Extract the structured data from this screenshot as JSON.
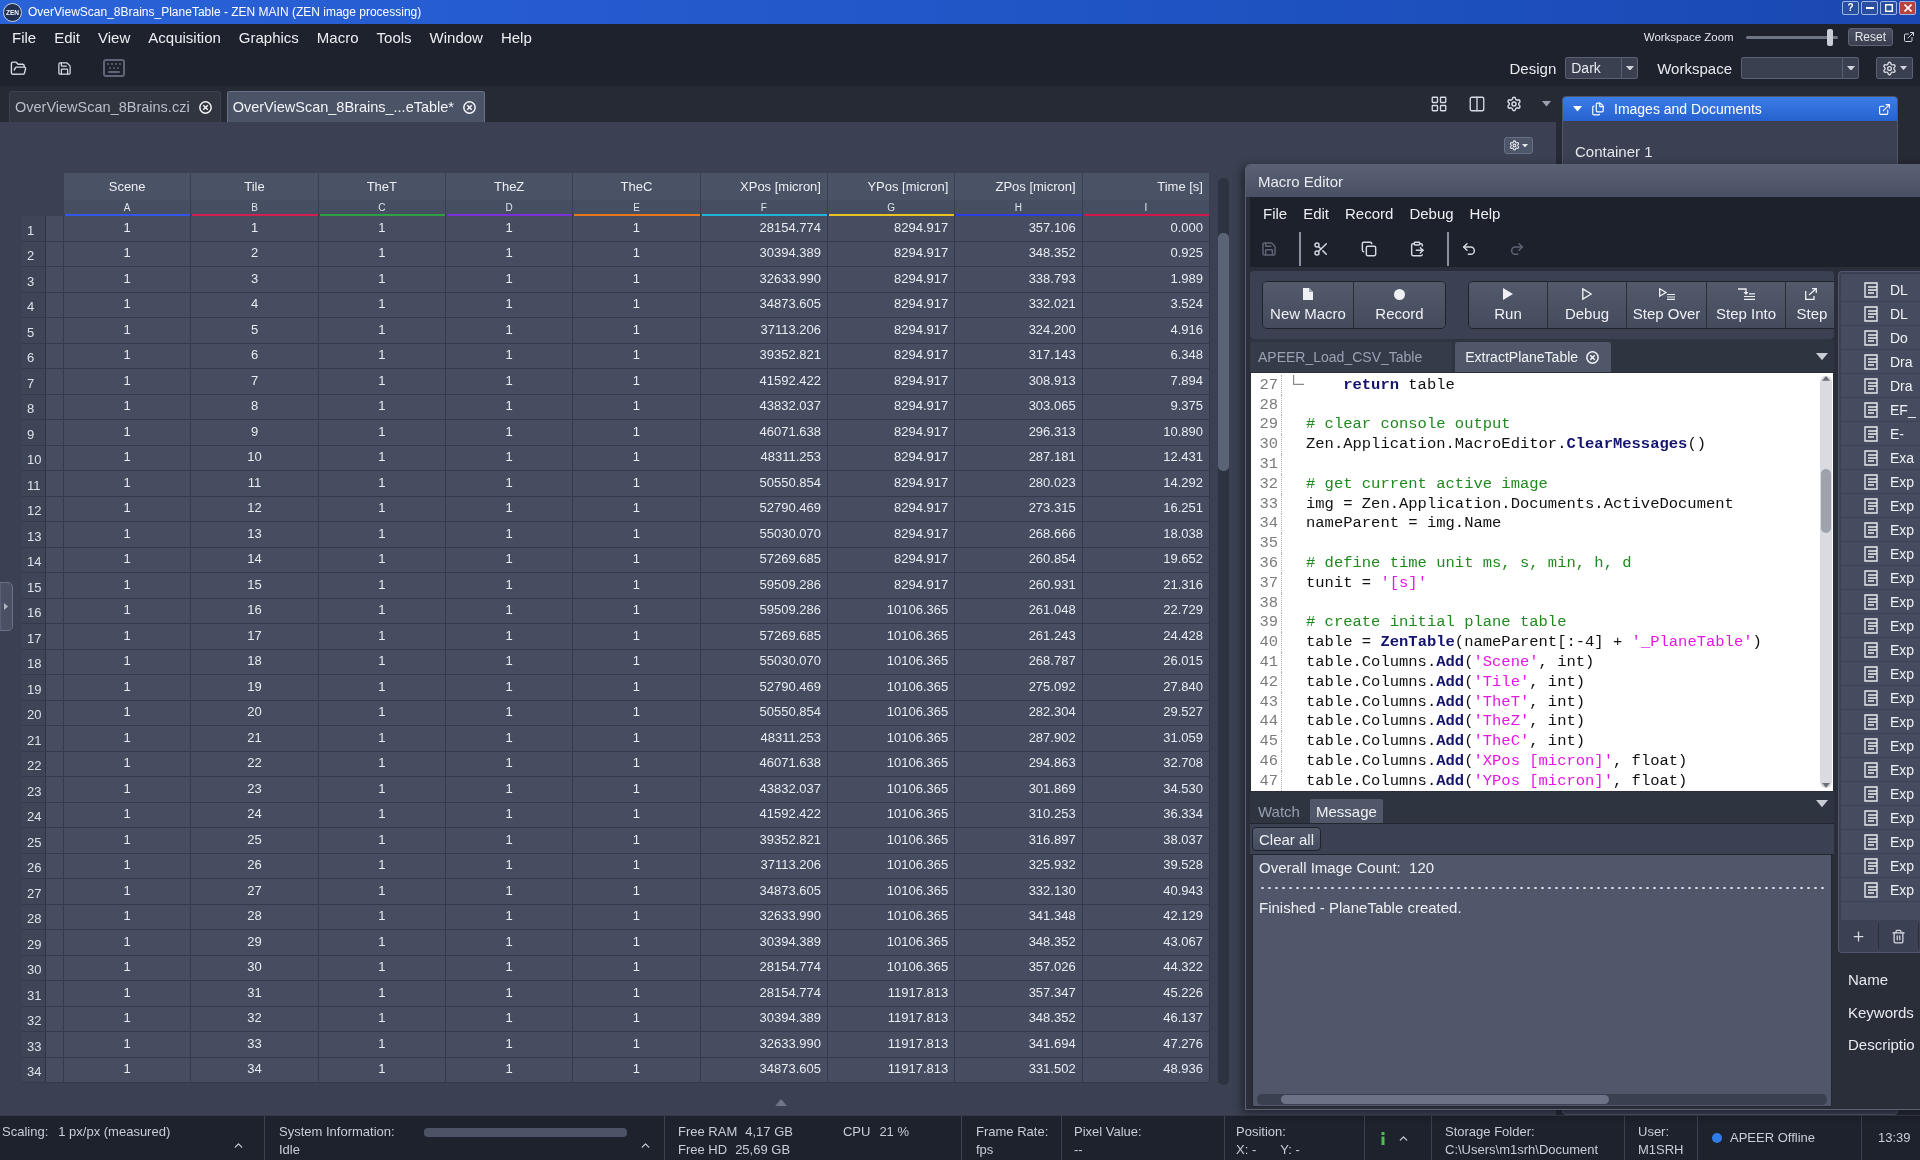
{
  "window": {
    "logo_text": "ZEN",
    "title": "OverViewScan_8Brains_PlaneTable - ZEN MAIN (ZEN image processing)",
    "help_button": "?"
  },
  "menu": [
    "File",
    "Edit",
    "View",
    "Acquisition",
    "Graphics",
    "Macro",
    "Tools",
    "Window",
    "Help"
  ],
  "workspace_zoom": {
    "label": "Workspace Zoom",
    "level": 0.92,
    "reset_button": "Reset"
  },
  "toolbar": {
    "buttons": [
      {
        "kind": "open",
        "disabled": false
      },
      {
        "kind": "save",
        "disabled": false
      },
      {
        "kind": "keyboard",
        "disabled": true
      }
    ],
    "design": {
      "label": "Design",
      "value": "Dark"
    },
    "workspace": {
      "label": "Workspace"
    }
  },
  "document_tabs": [
    {
      "label": "OverViewScan_8Brains.czi",
      "selected": false
    },
    {
      "label": "OverViewScan_8Brains_...eTable*",
      "selected": true
    }
  ],
  "table": {
    "columns": [
      {
        "name": "Scene",
        "letter": "A",
        "color": "#3355e8",
        "kind": "integer"
      },
      {
        "name": "Tile",
        "letter": "B",
        "color": "#d02050",
        "kind": "integer"
      },
      {
        "name": "TheT",
        "letter": "C",
        "color": "#2ea043",
        "kind": "integer"
      },
      {
        "name": "TheZ",
        "letter": "D",
        "color": "#7a2fd8",
        "kind": "integer"
      },
      {
        "name": "TheC",
        "letter": "E",
        "color": "#e8761e",
        "kind": "integer"
      },
      {
        "name": "XPos [micron]",
        "letter": "F",
        "color": "#1fb4d8",
        "kind": "decimal"
      },
      {
        "name": "YPos [micron]",
        "letter": "G",
        "color": "#e8c21e",
        "kind": "decimal"
      },
      {
        "name": "ZPos [micron]",
        "letter": "H",
        "color": "#2b3fe0",
        "kind": "decimal"
      },
      {
        "name": "Time [s]",
        "letter": "I",
        "color": "#d0184c",
        "kind": "decimal"
      }
    ],
    "rows": [
      {
        "number": "1",
        "cells": [
          "1",
          "1",
          "1",
          "1",
          "1",
          "28154.774",
          "8294.917",
          "357.106",
          "0.000"
        ]
      },
      {
        "number": "2",
        "cells": [
          "1",
          "2",
          "1",
          "1",
          "1",
          "30394.389",
          "8294.917",
          "348.352",
          "0.925"
        ]
      },
      {
        "number": "3",
        "cells": [
          "1",
          "3",
          "1",
          "1",
          "1",
          "32633.990",
          "8294.917",
          "338.793",
          "1.989"
        ]
      },
      {
        "number": "4",
        "cells": [
          "1",
          "4",
          "1",
          "1",
          "1",
          "34873.605",
          "8294.917",
          "332.021",
          "3.524"
        ]
      },
      {
        "number": "5",
        "cells": [
          "1",
          "5",
          "1",
          "1",
          "1",
          "37113.206",
          "8294.917",
          "324.200",
          "4.916"
        ]
      },
      {
        "number": "6",
        "cells": [
          "1",
          "6",
          "1",
          "1",
          "1",
          "39352.821",
          "8294.917",
          "317.143",
          "6.348"
        ]
      },
      {
        "number": "7",
        "cells": [
          "1",
          "7",
          "1",
          "1",
          "1",
          "41592.422",
          "8294.917",
          "308.913",
          "7.894"
        ]
      },
      {
        "number": "8",
        "cells": [
          "1",
          "8",
          "1",
          "1",
          "1",
          "43832.037",
          "8294.917",
          "303.065",
          "9.375"
        ]
      },
      {
        "number": "9",
        "cells": [
          "1",
          "9",
          "1",
          "1",
          "1",
          "46071.638",
          "8294.917",
          "296.313",
          "10.890"
        ]
      },
      {
        "number": "10",
        "cells": [
          "1",
          "10",
          "1",
          "1",
          "1",
          "48311.253",
          "8294.917",
          "287.181",
          "12.431"
        ]
      },
      {
        "number": "11",
        "cells": [
          "1",
          "11",
          "1",
          "1",
          "1",
          "50550.854",
          "8294.917",
          "280.023",
          "14.292"
        ]
      },
      {
        "number": "12",
        "cells": [
          "1",
          "12",
          "1",
          "1",
          "1",
          "52790.469",
          "8294.917",
          "273.315",
          "16.251"
        ]
      },
      {
        "number": "13",
        "cells": [
          "1",
          "13",
          "1",
          "1",
          "1",
          "55030.070",
          "8294.917",
          "268.666",
          "18.038"
        ]
      },
      {
        "number": "14",
        "cells": [
          "1",
          "14",
          "1",
          "1",
          "1",
          "57269.685",
          "8294.917",
          "260.854",
          "19.652"
        ]
      },
      {
        "number": "15",
        "cells": [
          "1",
          "15",
          "1",
          "1",
          "1",
          "59509.286",
          "8294.917",
          "260.931",
          "21.316"
        ]
      },
      {
        "number": "16",
        "cells": [
          "1",
          "16",
          "1",
          "1",
          "1",
          "59509.286",
          "10106.365",
          "261.048",
          "22.729"
        ]
      },
      {
        "number": "17",
        "cells": [
          "1",
          "17",
          "1",
          "1",
          "1",
          "57269.685",
          "10106.365",
          "261.243",
          "24.428"
        ]
      },
      {
        "number": "18",
        "cells": [
          "1",
          "18",
          "1",
          "1",
          "1",
          "55030.070",
          "10106.365",
          "268.787",
          "26.015"
        ]
      },
      {
        "number": "19",
        "cells": [
          "1",
          "19",
          "1",
          "1",
          "1",
          "52790.469",
          "10106.365",
          "275.092",
          "27.840"
        ]
      },
      {
        "number": "20",
        "cells": [
          "1",
          "20",
          "1",
          "1",
          "1",
          "50550.854",
          "10106.365",
          "282.304",
          "29.527"
        ]
      },
      {
        "number": "21",
        "cells": [
          "1",
          "21",
          "1",
          "1",
          "1",
          "48311.253",
          "10106.365",
          "287.902",
          "31.059"
        ]
      },
      {
        "number": "22",
        "cells": [
          "1",
          "22",
          "1",
          "1",
          "1",
          "46071.638",
          "10106.365",
          "294.863",
          "32.708"
        ]
      },
      {
        "number": "23",
        "cells": [
          "1",
          "23",
          "1",
          "1",
          "1",
          "43832.037",
          "10106.365",
          "301.869",
          "34.530"
        ]
      },
      {
        "number": "24",
        "cells": [
          "1",
          "24",
          "1",
          "1",
          "1",
          "41592.422",
          "10106.365",
          "310.253",
          "36.334"
        ]
      },
      {
        "number": "25",
        "cells": [
          "1",
          "25",
          "1",
          "1",
          "1",
          "39352.821",
          "10106.365",
          "316.897",
          "38.037"
        ]
      },
      {
        "number": "26",
        "cells": [
          "1",
          "26",
          "1",
          "1",
          "1",
          "37113.206",
          "10106.365",
          "325.932",
          "39.528"
        ]
      },
      {
        "number": "27",
        "cells": [
          "1",
          "27",
          "1",
          "1",
          "1",
          "34873.605",
          "10106.365",
          "332.130",
          "40.943"
        ]
      },
      {
        "number": "28",
        "cells": [
          "1",
          "28",
          "1",
          "1",
          "1",
          "32633.990",
          "10106.365",
          "341.348",
          "42.129"
        ]
      },
      {
        "number": "29",
        "cells": [
          "1",
          "29",
          "1",
          "1",
          "1",
          "30394.389",
          "10106.365",
          "348.352",
          "43.067"
        ]
      },
      {
        "number": "30",
        "cells": [
          "1",
          "30",
          "1",
          "1",
          "1",
          "28154.774",
          "10106.365",
          "357.026",
          "44.322"
        ]
      },
      {
        "number": "31",
        "cells": [
          "1",
          "31",
          "1",
          "1",
          "1",
          "28154.774",
          "11917.813",
          "357.347",
          "45.226"
        ]
      },
      {
        "number": "32",
        "cells": [
          "1",
          "32",
          "1",
          "1",
          "1",
          "30394.389",
          "11917.813",
          "348.352",
          "46.137"
        ]
      },
      {
        "number": "33",
        "cells": [
          "1",
          "33",
          "1",
          "1",
          "1",
          "32633.990",
          "11917.813",
          "341.694",
          "47.276"
        ]
      },
      {
        "number": "34",
        "cells": [
          "1",
          "34",
          "1",
          "1",
          "1",
          "34873.605",
          "11917.813",
          "331.502",
          "48.936"
        ]
      }
    ]
  },
  "images_panel": {
    "title": "Images and Documents",
    "expanded": true,
    "container": "Container 1"
  },
  "macro_editor": {
    "title": "Macro Editor",
    "menu": [
      "File",
      "Edit",
      "Record",
      "Debug",
      "Help"
    ],
    "toolbar_groups": [
      [
        {
          "kind": "save",
          "disabled": true
        }
      ],
      [
        {
          "kind": "cut",
          "disabled": false
        },
        {
          "kind": "copy",
          "disabled": false
        },
        {
          "kind": "paste",
          "disabled": false
        }
      ],
      [
        {
          "kind": "undo",
          "disabled": false
        },
        {
          "kind": "redo",
          "disabled": true
        }
      ]
    ],
    "button_groups": [
      [
        {
          "kind": "new",
          "label": "New Macro"
        },
        {
          "kind": "record",
          "label": "Record"
        }
      ],
      [
        {
          "kind": "run",
          "label": "Run"
        },
        {
          "kind": "debug",
          "label": "Debug"
        },
        {
          "kind": "step_over",
          "label": "Step Over"
        },
        {
          "kind": "step_into",
          "label": "Step Into"
        },
        {
          "kind": "step",
          "label": "Step"
        }
      ]
    ],
    "tabs": [
      {
        "label": "APEER_Load_CSV_Table",
        "selected": false
      },
      {
        "label": "ExtractPlaneTable",
        "selected": true
      }
    ],
    "code": [
      {
        "number": "27",
        "fold_end": true,
        "tokens": [
          {
            "kind": "keyword",
            "text": "    return"
          },
          {
            "kind": "plain",
            "text": " table"
          }
        ]
      },
      {
        "number": "28",
        "fold_end": false
      },
      {
        "number": "29",
        "fold_end": false,
        "tokens": [
          {
            "kind": "comment",
            "text": "# clear console output"
          }
        ]
      },
      {
        "number": "30",
        "fold_end": false,
        "tokens": [
          {
            "kind": "plain",
            "text": "Zen.Application.MacroEditor."
          },
          {
            "kind": "keyword",
            "text": "ClearMessages"
          },
          {
            "kind": "plain",
            "text": "()"
          }
        ]
      },
      {
        "number": "31",
        "fold_end": false
      },
      {
        "number": "32",
        "fold_end": false,
        "tokens": [
          {
            "kind": "comment",
            "text": "# get current active image"
          }
        ]
      },
      {
        "number": "33",
        "fold_end": false,
        "tokens": [
          {
            "kind": "plain",
            "text": "img = Zen.Application.Documents.ActiveDocument"
          }
        ]
      },
      {
        "number": "34",
        "fold_end": false,
        "tokens": [
          {
            "kind": "plain",
            "text": "nameParent = img.Name"
          }
        ]
      },
      {
        "number": "35",
        "fold_end": false
      },
      {
        "number": "36",
        "fold_end": false,
        "tokens": [
          {
            "kind": "comment",
            "text": "# define time unit ms, s, min, h, d"
          }
        ]
      },
      {
        "number": "37",
        "fold_end": false,
        "tokens": [
          {
            "kind": "plain",
            "text": "tunit = "
          },
          {
            "kind": "string",
            "text": "'[s]'"
          }
        ]
      },
      {
        "number": "38",
        "fold_end": false
      },
      {
        "number": "39",
        "fold_end": false,
        "tokens": [
          {
            "kind": "comment",
            "text": "# create initial plane table"
          }
        ]
      },
      {
        "number": "40",
        "fold_end": false,
        "tokens": [
          {
            "kind": "plain",
            "text": "table = "
          },
          {
            "kind": "keyword",
            "text": "ZenTable"
          },
          {
            "kind": "plain",
            "text": "(nameParent[:-4] + "
          },
          {
            "kind": "string",
            "text": "'_PlaneTable'"
          },
          {
            "kind": "plain",
            "text": ")"
          }
        ]
      },
      {
        "number": "41",
        "fold_end": false,
        "tokens": [
          {
            "kind": "plain",
            "text": "table.Columns."
          },
          {
            "kind": "keyword",
            "text": "Add"
          },
          {
            "kind": "plain",
            "text": "("
          },
          {
            "kind": "string",
            "text": "'Scene'"
          },
          {
            "kind": "plain",
            "text": ", int)"
          }
        ]
      },
      {
        "number": "42",
        "fold_end": false,
        "tokens": [
          {
            "kind": "plain",
            "text": "table.Columns."
          },
          {
            "kind": "keyword",
            "text": "Add"
          },
          {
            "kind": "plain",
            "text": "("
          },
          {
            "kind": "string",
            "text": "'Tile'"
          },
          {
            "kind": "plain",
            "text": ", int)"
          }
        ]
      },
      {
        "number": "43",
        "fold_end": false,
        "tokens": [
          {
            "kind": "plain",
            "text": "table.Columns."
          },
          {
            "kind": "keyword",
            "text": "Add"
          },
          {
            "kind": "plain",
            "text": "("
          },
          {
            "kind": "string",
            "text": "'TheT'"
          },
          {
            "kind": "plain",
            "text": ", int)"
          }
        ]
      },
      {
        "number": "44",
        "fold_end": false,
        "tokens": [
          {
            "kind": "plain",
            "text": "table.Columns."
          },
          {
            "kind": "keyword",
            "text": "Add"
          },
          {
            "kind": "plain",
            "text": "("
          },
          {
            "kind": "string",
            "text": "'TheZ'"
          },
          {
            "kind": "plain",
            "text": ", int)"
          }
        ]
      },
      {
        "number": "45",
        "fold_end": false,
        "tokens": [
          {
            "kind": "plain",
            "text": "table.Columns."
          },
          {
            "kind": "keyword",
            "text": "Add"
          },
          {
            "kind": "plain",
            "text": "("
          },
          {
            "kind": "string",
            "text": "'TheC'"
          },
          {
            "kind": "plain",
            "text": ", int)"
          }
        ]
      },
      {
        "number": "46",
        "fold_end": false,
        "tokens": [
          {
            "kind": "plain",
            "text": "table.Columns."
          },
          {
            "kind": "keyword",
            "text": "Add"
          },
          {
            "kind": "plain",
            "text": "("
          },
          {
            "kind": "string",
            "text": "'XPos [micron]'"
          },
          {
            "kind": "plain",
            "text": ", float)"
          }
        ]
      },
      {
        "number": "47",
        "fold_end": false,
        "tokens": [
          {
            "kind": "plain",
            "text": "table.Columns."
          },
          {
            "kind": "keyword",
            "text": "Add"
          },
          {
            "kind": "plain",
            "text": "("
          },
          {
            "kind": "string",
            "text": "'YPos [micron]'"
          },
          {
            "kind": "plain",
            "text": ", float)"
          }
        ]
      }
    ],
    "output_tabs": [
      {
        "label": "Watch",
        "selected": false
      },
      {
        "label": "Message",
        "selected": true
      }
    ],
    "clear_button": "Clear all",
    "messages": [
      "Overall Image Count:  120",
      "Finished - PlaneTable created."
    ],
    "macro_list": [
      "DL",
      "DL",
      "Do",
      "Dra",
      "Dra",
      "EF_",
      "E-",
      "Exa",
      "Exp",
      "Exp",
      "Exp",
      "Exp",
      "Exp",
      "Exp",
      "Exp",
      "Exp",
      "Exp",
      "Exp",
      "Exp",
      "Exp",
      "Exp",
      "Exp",
      "Exp",
      "Exp",
      "Exp",
      "Exp"
    ],
    "properties": [
      "Name",
      "Keywords",
      "Descriptio"
    ]
  },
  "status_bar": [
    {
      "kind": "scaling",
      "label": "Scaling:",
      "value": "1 px/px (measured)"
    },
    {
      "kind": "system",
      "label": "System Information:",
      "value": "Idle"
    },
    {
      "kind": "resources",
      "lines": [
        {
          "label": "Free RAM",
          "value": "4,17 GB"
        },
        {
          "label": "Free HD",
          "value": "25,69 GB"
        }
      ],
      "cpu": {
        "label": "CPU",
        "value": "21 %"
      }
    },
    {
      "kind": "field",
      "label": "Frame Rate:",
      "value": "fps"
    },
    {
      "kind": "field",
      "label": "Pixel Value:",
      "value": "--"
    },
    {
      "kind": "position",
      "label": "Position:",
      "x": "X: -",
      "y": "Y: -"
    },
    {
      "kind": "info"
    },
    {
      "kind": "field",
      "label": "Storage Folder:",
      "value": "C:\\Users\\m1srh\\Document"
    },
    {
      "kind": "field",
      "label": "User:",
      "value": "M1SRH"
    },
    {
      "kind": "connection",
      "label": "APEER Offline",
      "color": "#2f7de8"
    },
    {
      "kind": "clock",
      "value": "13:39"
    }
  ]
}
